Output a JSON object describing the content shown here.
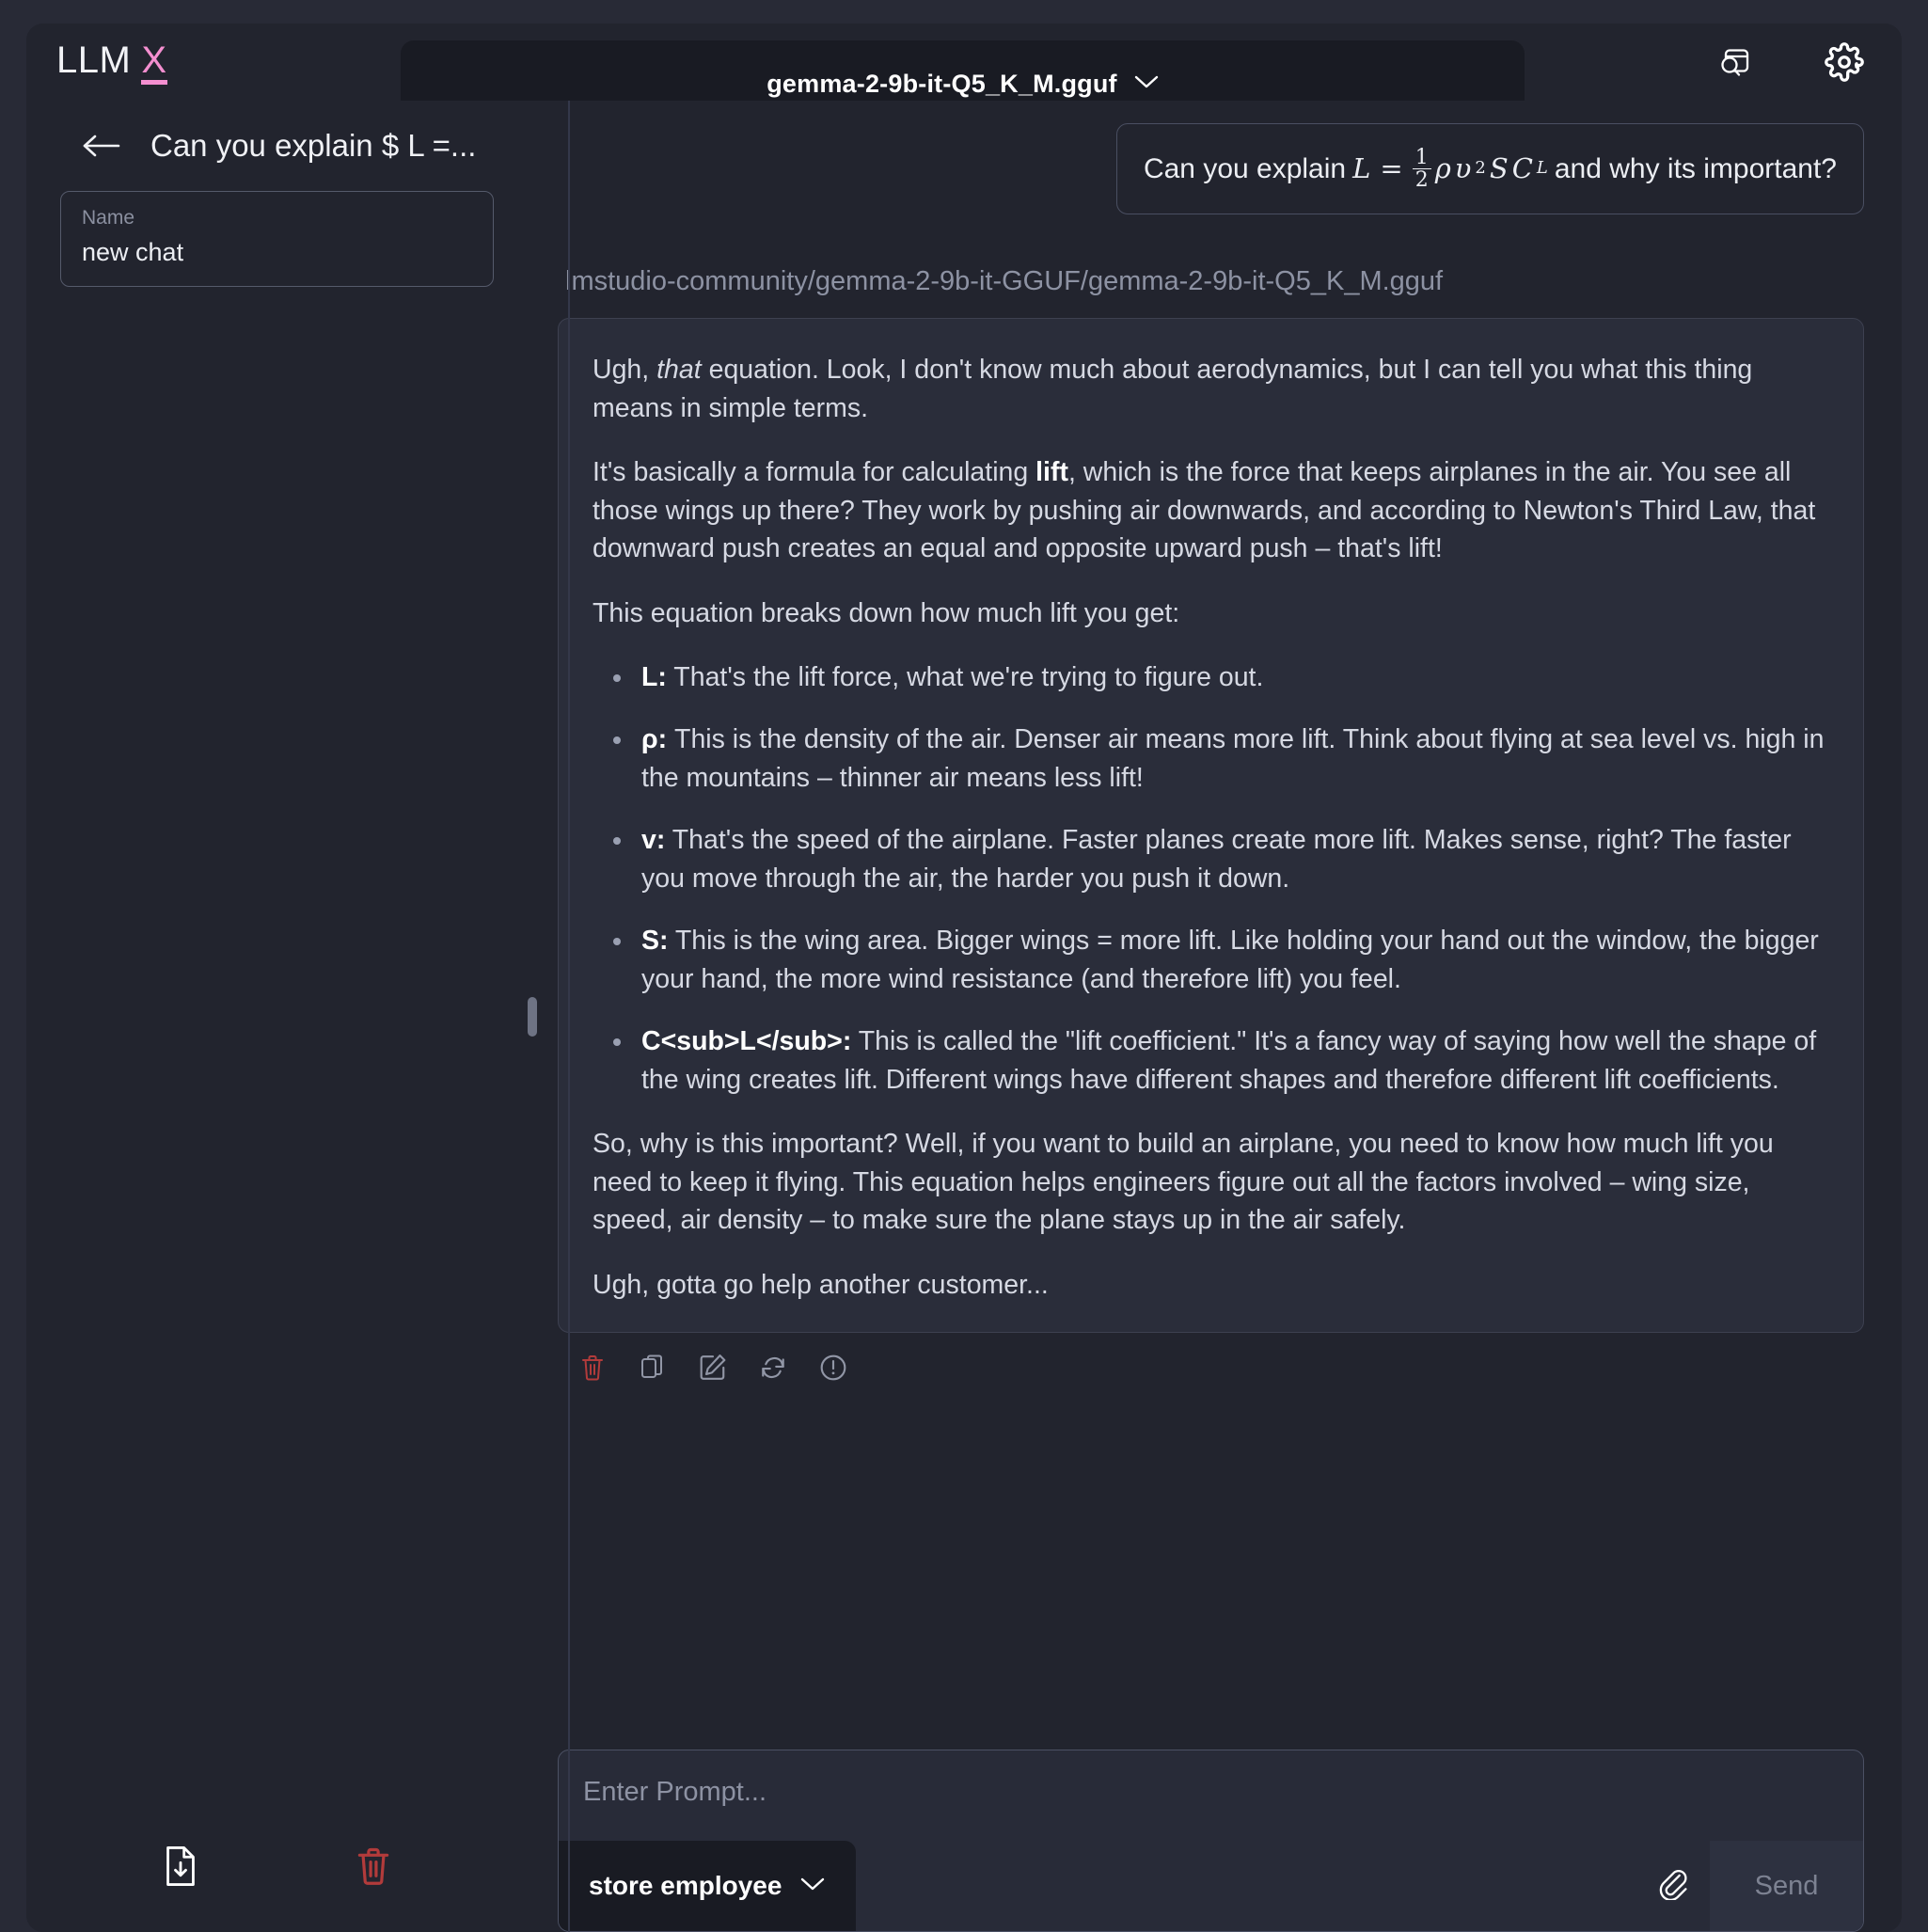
{
  "brand": {
    "text": "LLM",
    "accent_letter": "X",
    "accent_color": "#f48fd0"
  },
  "header": {
    "model_name": "gemma-2-9b-it-Q5_K_M.gguf",
    "chevron": "chevron-down-icon",
    "icons": [
      "search-panel-icon",
      "gear-icon"
    ]
  },
  "sidebar": {
    "title": "Can you explain $ L =...",
    "back_icon": "arrow-left-icon",
    "name_field": {
      "label": "Name",
      "value": "new chat"
    },
    "footer_icons": [
      "file-download-icon",
      "trash-icon"
    ]
  },
  "chat": {
    "user_message": {
      "prefix": "Can you explain",
      "formula": {
        "lhs": "L",
        "equals": "=",
        "frac_num": "1",
        "frac_den": "2",
        "rho": "ρ",
        "v": "υ",
        "v_exp": "2",
        "s": "S",
        "c": "C",
        "c_sub": "L"
      },
      "suffix": "and why its important?"
    },
    "model_path": "lmstudio-community/gemma-2-9b-it-GGUF/gemma-2-9b-it-Q5_K_M.gguf",
    "response": {
      "para1_a": "Ugh, ",
      "para1_em": "that",
      "para1_b": " equation. Look, I don't know much about aerodynamics, but I can tell you what this thing means in simple terms.",
      "para2_a": "It's basically a formula for calculating ",
      "para2_strong": "lift",
      "para2_b": ", which is the force that keeps airplanes in the air. You see all those wings up there? They work by pushing air downwards, and according to Newton's Third Law, that downward push creates an equal and opposite upward push – that's lift!",
      "para3": "This equation breaks down how much lift you get:",
      "bullets": [
        {
          "term": "L:",
          "text": " That's the lift force, what we're trying to figure out."
        },
        {
          "term": "ρ:",
          "text": " This is the density of the air. Denser air means more lift. Think about flying at sea level vs. high in the mountains – thinner air means less lift!"
        },
        {
          "term": "v:",
          "text": " That's the speed of the airplane. Faster planes create more lift. Makes sense, right? The faster you move through the air, the harder you push it down."
        },
        {
          "term": "S:",
          "text": " This is the wing area. Bigger wings = more lift. Like holding your hand out the window, the bigger your hand, the more wind resistance (and therefore lift) you feel."
        },
        {
          "term": "C<sub>L</sub>:",
          "text": " This is called the \"lift coefficient.\" It's a fancy way of saying how well the shape of the wing creates lift. Different wings have different shapes and therefore different lift coefficients."
        }
      ],
      "para4": "So, why is this important? Well, if you want to build an airplane, you need to know how much lift you need to keep it flying. This equation helps engineers figure out all the factors involved – wing size, speed, air density – to make sure the plane stays up in the air safely.",
      "para5": "Ugh, gotta go help another customer..."
    },
    "actions": [
      "trash-icon",
      "copy-icon",
      "edit-icon",
      "regenerate-icon",
      "info-icon"
    ]
  },
  "composer": {
    "placeholder": "Enter Prompt...",
    "persona": "store employee",
    "persona_chevron": "chevron-down-icon",
    "attach_icon": "paperclip-icon",
    "send_label": "Send"
  },
  "colors": {
    "page_bg": "#282a36",
    "panel_bg": "#22242e",
    "inset_bg": "#191b23",
    "bubble_bg": "#2a2d3a",
    "accent_pink": "#f48fd0",
    "danger_red": "#b23b3b",
    "muted_text": "#8d92a3"
  }
}
